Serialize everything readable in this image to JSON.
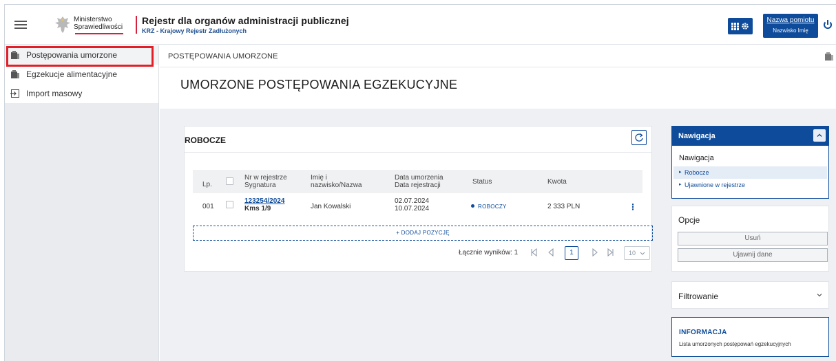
{
  "header": {
    "logo_line1": "Ministerstwo",
    "logo_line2": "Sprawiedliwości",
    "title": "Rejestr dla organów administracji publicznej",
    "subtitle": "KRZ - Krajowy Rejestr Zadłużonych",
    "user_name": "Nazwa pomiotu",
    "user_role": "Nazwisko Imię"
  },
  "sidebar": {
    "items": [
      {
        "label": "Postępowania umorzone"
      },
      {
        "label": "Egzekucje alimentacyjne"
      },
      {
        "label": "Import masowy"
      }
    ]
  },
  "breadcrumb": "POSTĘPOWANIA UMORZONE",
  "page_title": "UMORZONE POSTĘPOWANIA EGZEKUCYJNE",
  "card": {
    "title": "ROBOCZE",
    "columns": {
      "lp": "Lp.",
      "nr_line1": "Nr w rejestrze",
      "nr_line2": "Sygnatura",
      "name_line1": "Imię i",
      "name_line2": "nazwisko/Nazwa",
      "date_line1": "Data umorzenia",
      "date_line2": "Data rejestracji",
      "status": "Status",
      "amount": "Kwota"
    },
    "rows": [
      {
        "lp": "001",
        "nr": "123254/2024",
        "sygn": "Kms 1/9",
        "name": "Jan Kowalski",
        "date_umorzenia": "02.07.2024",
        "date_rejestracji": "10.07.2024",
        "status": "ROBOCZY",
        "amount": "2 333 PLN"
      }
    ],
    "add_label": "+ DODAJ POZYCJĘ",
    "total_label": "Łącznie wyników: 1",
    "page": "1",
    "page_size": "10"
  },
  "nav_panel": {
    "header": "Nawigacja",
    "subtitle": "Nawigacja",
    "links": [
      {
        "label": "Robocze"
      },
      {
        "label": "Ujawnione w rejestrze"
      }
    ]
  },
  "options": {
    "title": "Opcje",
    "delete_label": "Usuń",
    "reveal_label": "Ujawnij dane"
  },
  "filter": {
    "title": "Filtrowanie"
  },
  "info": {
    "title": "INFORMACJA",
    "text": "Lista umorzonych postępowań egzekucyjnych"
  },
  "colors": {
    "primary": "#0e4c9b",
    "accent_red": "#d4213d",
    "highlight_outline": "#e21f26"
  }
}
